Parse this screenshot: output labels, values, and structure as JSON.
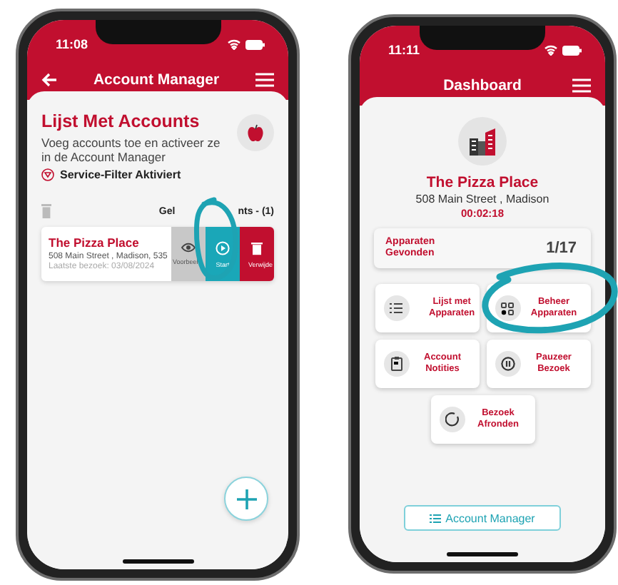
{
  "left_phone": {
    "status_bar": {
      "time": "11:08"
    },
    "header": {
      "title": "Account Manager"
    },
    "intro": {
      "title": "Lijst Met Accounts",
      "description": "Voeg accounts toe en activeer ze in de Account Manager",
      "filter_label": "Service-Filter Aktiviert"
    },
    "list_label_parts": [
      "Gel",
      "nts - (1)"
    ],
    "accounts": [
      {
        "name": "The Pizza Place",
        "address": "508 Main Street , Madison, 535",
        "last_visit": "Laatste bezoek: 03/08/2024",
        "actions": [
          {
            "kind": "view",
            "label": "Voorbeel"
          },
          {
            "kind": "start",
            "label": "Start"
          },
          {
            "kind": "delete",
            "label": "Verwijde"
          }
        ]
      }
    ]
  },
  "right_phone": {
    "status_bar": {
      "time": "11:11"
    },
    "header": {
      "title": "Dashboard"
    },
    "account": {
      "name": "The Pizza Place",
      "address": "508 Main Street , Madison",
      "timer": "00:02:18"
    },
    "devices_found": {
      "label": "Apparaten Gevonden",
      "value": "1/17"
    },
    "actions": [
      {
        "kind": "list",
        "label": "Lijst met Apparaten"
      },
      {
        "kind": "manage",
        "label": "Beheer Apparaten"
      },
      {
        "kind": "notes",
        "label": "Account Notities"
      },
      {
        "kind": "pause",
        "label": "Pauzeer Bezoek"
      },
      {
        "kind": "finish",
        "label": "Bezoek Afronden"
      }
    ],
    "footer_button": {
      "label": "Account Manager"
    }
  }
}
